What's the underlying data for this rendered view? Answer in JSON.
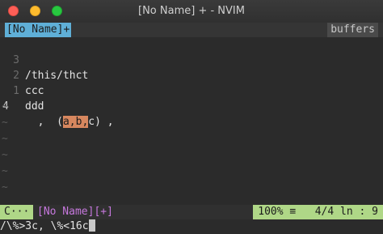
{
  "window": {
    "title": "[No Name] + - NVIM"
  },
  "tabline": {
    "active_tab": "[No Name]+",
    "buffers_label": "buffers"
  },
  "editor": {
    "lines": [
      {
        "number": "3",
        "text": "/this/thct"
      },
      {
        "number": "2",
        "text": "ccc"
      },
      {
        "number": "1",
        "text": "ddd"
      }
    ],
    "current_line": {
      "number": "4",
      "prefix": "  ,  (",
      "hl_a": "a,",
      "mid_b": "b",
      "hl_b": ",",
      "suffix": "c) ,"
    },
    "empty_marker": "~"
  },
  "statusline": {
    "mode": "C···",
    "file": "[No Name][+]",
    "percent": "100% ≡",
    "position": "4/4 ln :  9"
  },
  "cmdline": {
    "text": "/\\%>3c, \\%<16c"
  },
  "colors": {
    "tab_active": "#5fafd7",
    "mode_bg": "#afd787",
    "match_highlight": "#d7875f",
    "file_name": "#c678dd"
  }
}
